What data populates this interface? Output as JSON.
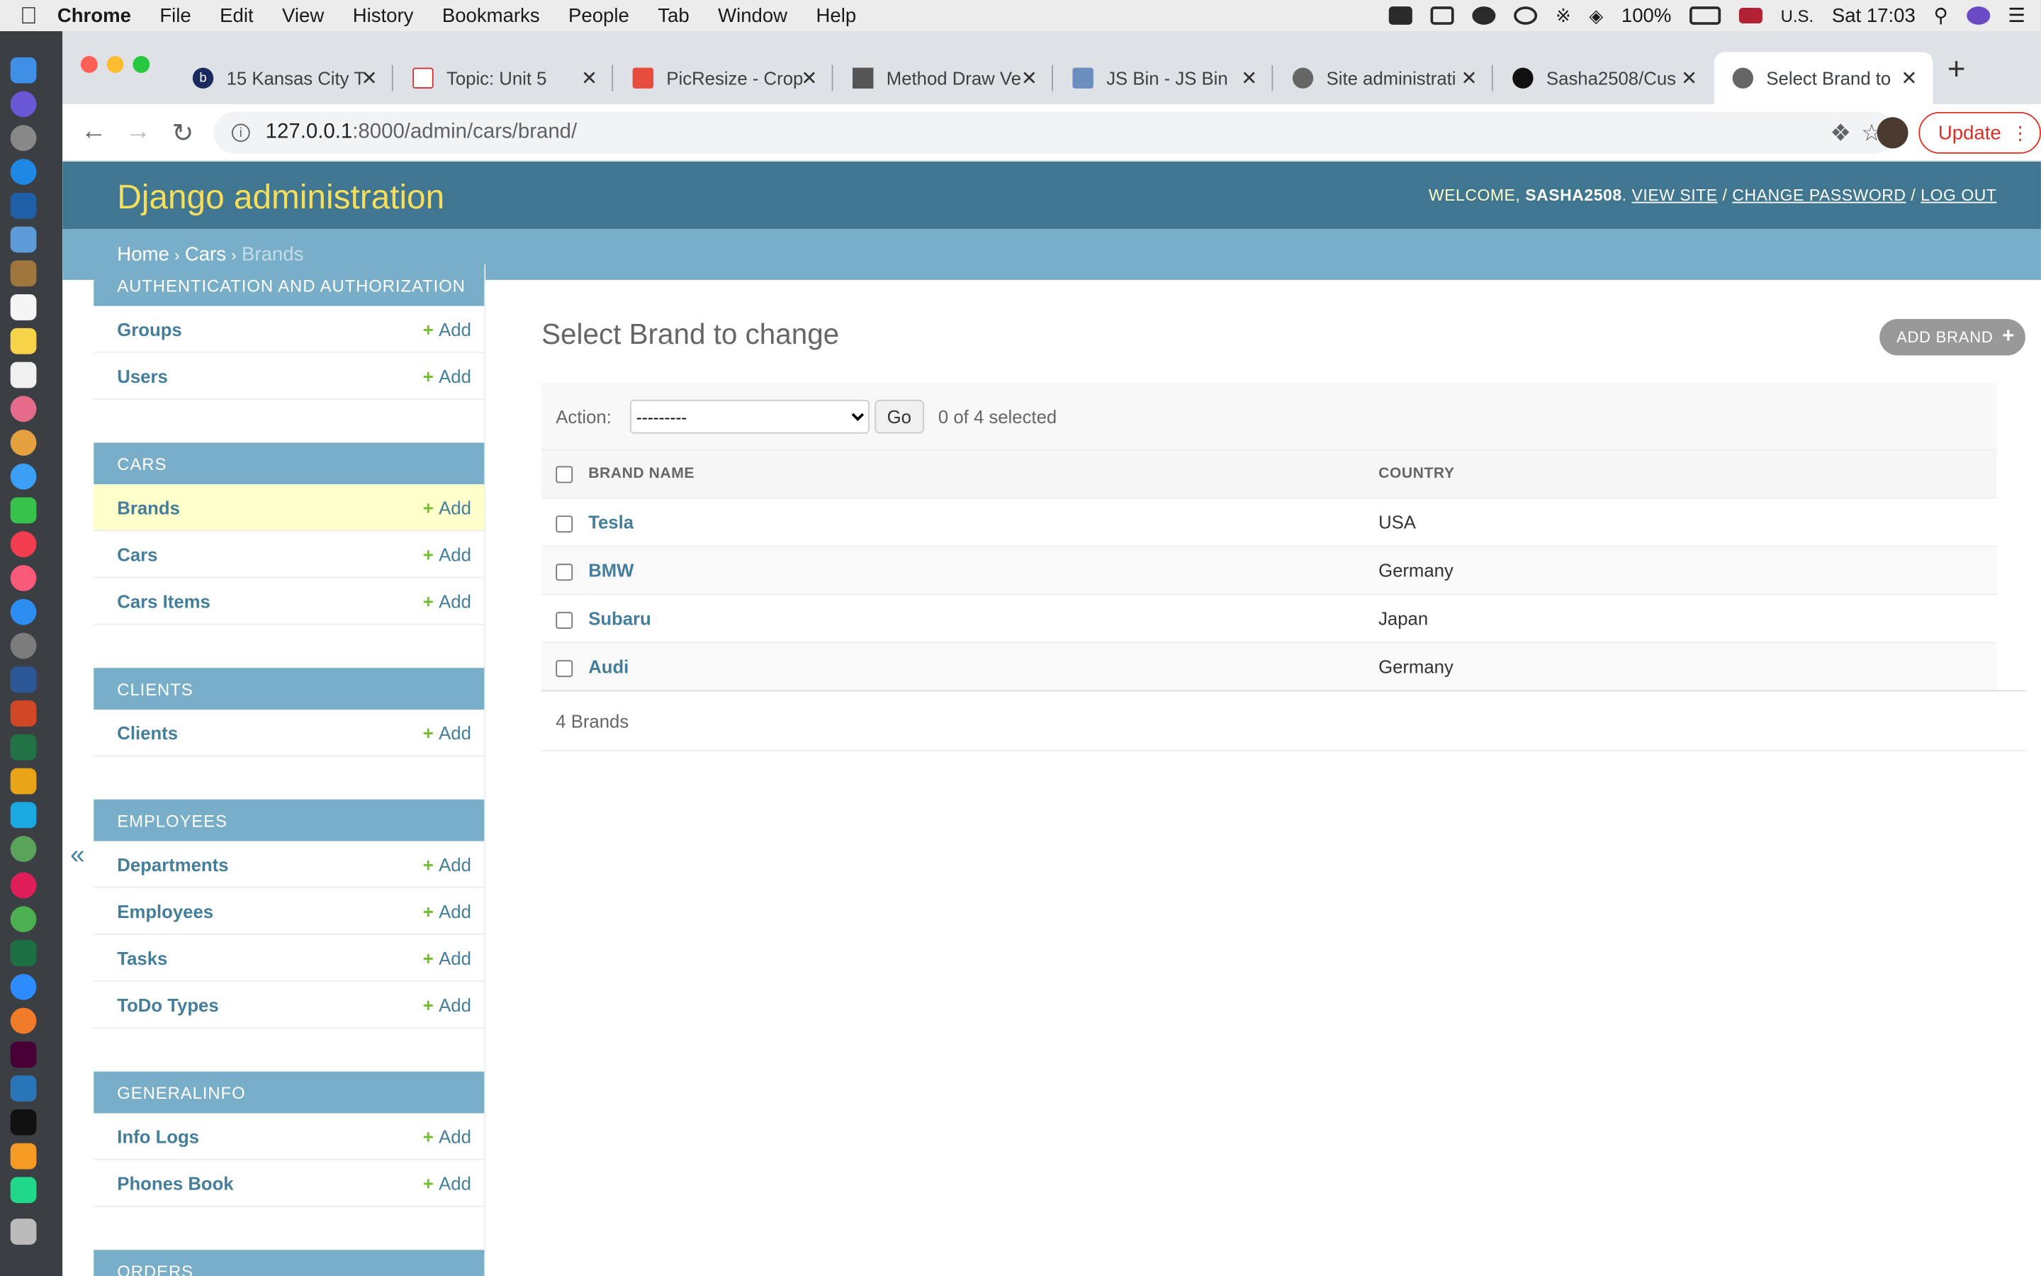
{
  "menubar": {
    "app": "Chrome",
    "items": [
      "File",
      "Edit",
      "View",
      "History",
      "Bookmarks",
      "People",
      "Tab",
      "Window",
      "Help"
    ],
    "battery": "100%",
    "input_source": "U.S.",
    "clock": "Sat 17:03"
  },
  "browser": {
    "tabs": [
      {
        "title": "15 Kansas City T",
        "favicon": "b"
      },
      {
        "title": "Topic: Unit 5",
        "favicon": ""
      },
      {
        "title": "PicResize - Crop",
        "favicon": ""
      },
      {
        "title": "Method Draw Ve",
        "favicon": ""
      },
      {
        "title": "JS Bin - JS Bin",
        "favicon": ""
      },
      {
        "title": "Site administrati",
        "favicon": ""
      },
      {
        "title": "Sasha2508/Cus",
        "favicon": ""
      },
      {
        "title": "Select Brand to",
        "favicon": ""
      }
    ],
    "url_host": "127.0.0.1",
    "url_rest": ":8000/admin/cars/brand/",
    "update_label": "Update"
  },
  "admin": {
    "brand": "Django administration",
    "welcome": "WELCOME, ",
    "username": "SASHA2508",
    "view_site": "VIEW SITE",
    "change_password": "CHANGE PASSWORD",
    "log_out": "LOG OUT",
    "breadcrumbs": {
      "home": "Home",
      "app": "Cars",
      "current": "Brands"
    },
    "add_label": "Add",
    "modules": [
      {
        "caption": "AUTHENTICATION AND AUTHORIZATION",
        "models": [
          "Groups",
          "Users"
        ]
      },
      {
        "caption": "CARS",
        "models": [
          "Brands",
          "Cars",
          "Cars Items"
        ]
      },
      {
        "caption": "CLIENTS",
        "models": [
          "Clients"
        ]
      },
      {
        "caption": "EMPLOYEES",
        "models": [
          "Departments",
          "Employees",
          "Tasks",
          "ToDo Types"
        ]
      },
      {
        "caption": "GENERALINFO",
        "models": [
          "Info Logs",
          "Phones Book"
        ]
      },
      {
        "caption": "ORDERS",
        "models": []
      }
    ],
    "selected_model": "Brands",
    "title": "Select Brand to change",
    "add_button": "ADD BRAND",
    "action_label": "Action:",
    "action_value": "---------",
    "go_label": "Go",
    "selected_count": "0 of 4 selected",
    "columns": [
      "BRAND NAME",
      "COUNTRY"
    ],
    "rows": [
      {
        "name": "Tesla",
        "country": "USA"
      },
      {
        "name": "BMW",
        "country": "Germany"
      },
      {
        "name": "Subaru",
        "country": "Japan"
      },
      {
        "name": "Audi",
        "country": "Germany"
      }
    ],
    "result_count": "4 Brands"
  },
  "colors": {
    "header": "#417690",
    "crumbs": "#79aec8",
    "brand": "#f5dd5d",
    "link": "#447e9b",
    "add_plus": "#70bf2b"
  }
}
